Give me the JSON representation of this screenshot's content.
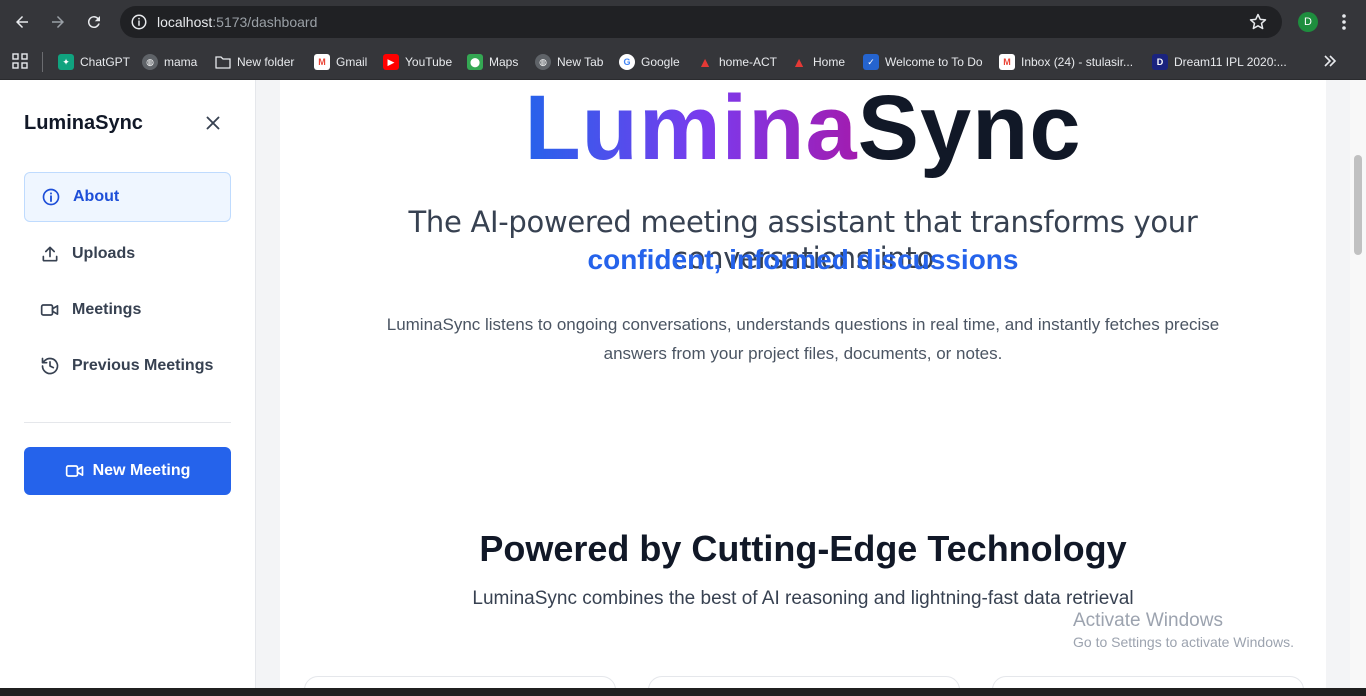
{
  "browser": {
    "url_host": "localhost",
    "url_path": ":5173/dashboard",
    "profile_initial": "D",
    "bookmarks": [
      {
        "label": "ChatGPT",
        "color": "#10a37f"
      },
      {
        "label": "mama",
        "color": "#5f6368"
      },
      {
        "label": "New folder",
        "color": "#9aa0a6"
      },
      {
        "label": "Gmail",
        "color": "#ea4335"
      },
      {
        "label": "YouTube",
        "color": "#ff0000"
      },
      {
        "label": "Maps",
        "color": "#34a853"
      },
      {
        "label": "New Tab",
        "color": "#5f6368"
      },
      {
        "label": "Google",
        "color": "#4285f4"
      },
      {
        "label": "home-ACT",
        "color": "#e53935"
      },
      {
        "label": "Home",
        "color": "#e53935"
      },
      {
        "label": "Welcome to To Do",
        "color": "#2564cf"
      },
      {
        "label": "Inbox (24) - stulasir...",
        "color": "#ea4335"
      },
      {
        "label": "Dream11 IPL 2020:...",
        "color": "#1a237e"
      }
    ]
  },
  "sidebar": {
    "brand": "LuminaSync",
    "items": [
      {
        "label": "About",
        "icon": "info-icon",
        "active": true
      },
      {
        "label": "Uploads",
        "icon": "upload-icon",
        "active": false
      },
      {
        "label": "Meetings",
        "icon": "video-icon",
        "active": false
      },
      {
        "label": "Previous Meetings",
        "icon": "history-icon",
        "active": false
      }
    ],
    "new_meeting_label": "New Meeting"
  },
  "main": {
    "hero_part1": "Lumina",
    "hero_part2": "Sync",
    "tagline": "The AI-powered meeting assistant that transforms your conversations into",
    "tagline_highlight": "confident, informed discussions",
    "description": "LuminaSync listens to ongoing conversations, understands questions in real time, and instantly fetches precise answers from your project files, documents, or notes.",
    "section_title": "Powered by Cutting-Edge Technology",
    "section_subtitle": "LuminaSync combines the best of AI reasoning and lightning-fast data retrieval"
  },
  "watermark": {
    "line1": "Activate Windows",
    "line2": "Go to Settings to activate Windows."
  },
  "colors": {
    "accent": "#2563eb",
    "gradient_start": "#2563eb",
    "gradient_end": "#a21caf"
  }
}
